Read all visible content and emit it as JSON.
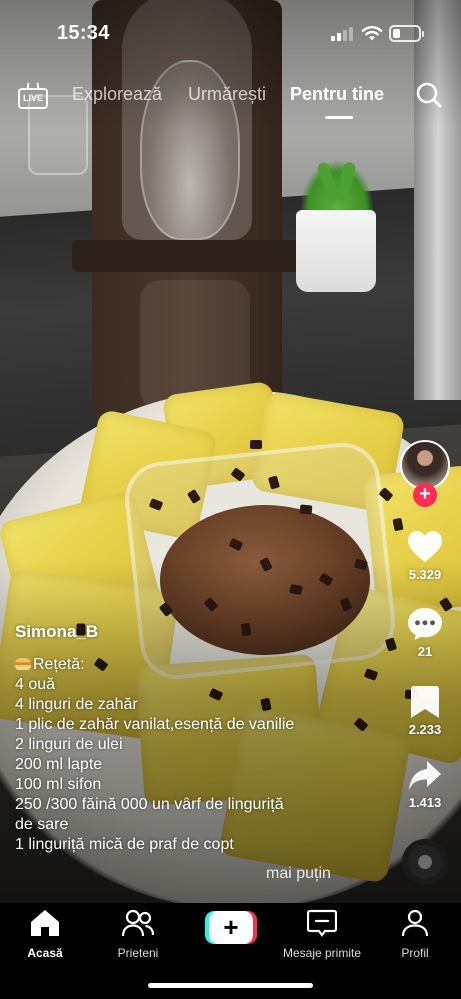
{
  "status_bar": {
    "time": "15:34",
    "battery_level": 0.3
  },
  "top_nav": {
    "live_label": "LIVE",
    "tabs": [
      {
        "label": "Explorează"
      },
      {
        "label": "Urmărești"
      },
      {
        "label": "Pentru tine",
        "active": true
      }
    ]
  },
  "actions": {
    "likes": "5.329",
    "comments": "21",
    "saves": "2.233",
    "shares": "1.413"
  },
  "post": {
    "author": "Simona_B",
    "caption_lines": [
      "Rețetă:",
      "4 ouă",
      "4 linguri de zahăr",
      "1 plic de zahăr vanilat,esență de vanilie",
      "2 linguri de ulei",
      "200 ml lapte",
      "100 ml sifon",
      "250 /300 făină 000 un vârf de linguriță",
      "de sare",
      "1 linguriță mică de praf de copt"
    ],
    "less_label": "mai puțin"
  },
  "tab_bar": {
    "tabs": [
      {
        "label": "Acasă",
        "icon": "home-icon",
        "active": true
      },
      {
        "label": "Prieteni",
        "icon": "friends-icon"
      },
      {
        "label": "",
        "icon": "create-icon"
      },
      {
        "label": "Mesaje primite",
        "icon": "inbox-icon"
      },
      {
        "label": "Profil",
        "icon": "profile-icon"
      }
    ]
  },
  "colors": {
    "accent_red": "#fe2c55",
    "accent_cyan": "#25f4ee"
  }
}
